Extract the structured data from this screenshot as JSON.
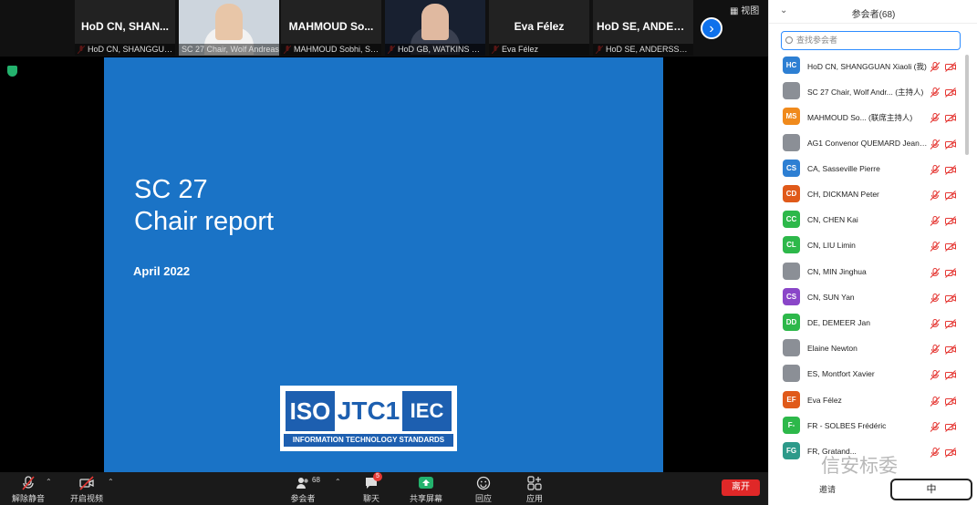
{
  "strip": {
    "thumbnails": [
      {
        "name": "HoD CN, SHAN...",
        "caption": "HoD CN, SHANGGUA..."
      },
      {
        "name": "",
        "caption": "SC 27 Chair, Wolf Andreas"
      },
      {
        "name": "MAHMOUD So...",
        "caption": "MAHMOUD Sobhi, SC ..."
      },
      {
        "name": "",
        "caption": "HoD GB, WATKINS Ste..."
      },
      {
        "name": "Eva Félez",
        "caption": "Eva Félez"
      },
      {
        "name": "HoD SE, ANDER...",
        "caption": "HoD SE, ANDERSSON ..."
      }
    ],
    "next_icon": "chevron-right-icon",
    "view_label": "视图"
  },
  "slide": {
    "title_line1": "SC 27",
    "title_line2": "Chair report",
    "date": "April 2022",
    "logo_iso": "ISO",
    "logo_jtc": "JTC1",
    "logo_iec": "IEC",
    "logo_tagline": "INFORMATION TECHNOLOGY STANDARDS"
  },
  "toolbar": {
    "unmute": "解除静音",
    "start_video": "开启视频",
    "participants": "参会者",
    "participants_count": "68",
    "chat": "聊天",
    "chat_badge": "5",
    "share": "共享屏幕",
    "reactions": "回应",
    "apps": "应用",
    "leave": "离开"
  },
  "panel": {
    "title": "参会者(68)",
    "search_placeholder": "查找参会者",
    "invite": "邀请",
    "participants": [
      {
        "initials": "HC",
        "color": "#2d7fd3",
        "name": "HoD CN, SHANGGUAN Xiaoli (我)"
      },
      {
        "initials": "",
        "color": "",
        "name": "SC 27 Chair, Wolf Andr... (主持人)"
      },
      {
        "initials": "MS",
        "color": "#f08a1c",
        "name": "MAHMOUD So... (联席主持人)"
      },
      {
        "initials": "",
        "color": "",
        "name": "AG1 Convenor QUEMARD Jean-..."
      },
      {
        "initials": "CS",
        "color": "#2d7fd3",
        "name": "CA, Sasseville Pierre"
      },
      {
        "initials": "CD",
        "color": "#e05a1a",
        "name": "CH, DICKMAN Peter"
      },
      {
        "initials": "CC",
        "color": "#2db84a",
        "name": "CN, CHEN Kai"
      },
      {
        "initials": "CL",
        "color": "#2db84a",
        "name": "CN, LIU Limin"
      },
      {
        "initials": "",
        "color": "",
        "name": "CN, MIN Jinghua"
      },
      {
        "initials": "CS",
        "color": "#8a46c8",
        "name": "CN, SUN Yan"
      },
      {
        "initials": "DD",
        "color": "#2db84a",
        "name": "DE, DEMEER Jan"
      },
      {
        "initials": "",
        "color": "",
        "name": "Elaine Newton"
      },
      {
        "initials": "",
        "color": "",
        "name": "ES, Montfort Xavier"
      },
      {
        "initials": "EF",
        "color": "#e05a1a",
        "name": "Eva Félez"
      },
      {
        "initials": "F-",
        "color": "#2db84a",
        "name": "FR - SOLBES Frédéric"
      },
      {
        "initials": "FG",
        "color": "#2d9a8a",
        "name": "FR, Gratand..."
      }
    ]
  },
  "watermark": {
    "text": "信安标委",
    "badge": "中"
  }
}
